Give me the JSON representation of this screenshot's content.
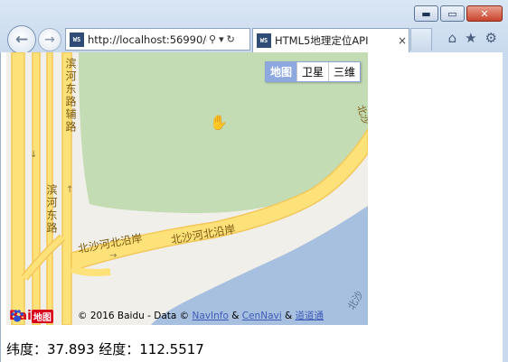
{
  "window": {
    "controls": [
      "minimize-icon",
      "maximize-icon",
      "close-icon"
    ],
    "minimize_glyph": "▬",
    "maximize_glyph": "▭",
    "close_glyph": "✕"
  },
  "nav": {
    "back_glyph": "←",
    "forward_glyph": "→"
  },
  "address_bar": {
    "favicon_text": "WS",
    "url": "http://localhost:56990/c",
    "search_glyph": "⚲",
    "dropdown_glyph": "▾",
    "refresh_glyph": "↻"
  },
  "tab": {
    "favicon_text": "WS",
    "title": "HTML5地理定位API",
    "close_glyph": "×"
  },
  "toolbar": {
    "home_glyph": "⌂",
    "favorites_glyph": "★",
    "settings_glyph": "⚙"
  },
  "map": {
    "type_buttons": [
      {
        "label": "地图",
        "active": true
      },
      {
        "label": "卫星",
        "active": false
      },
      {
        "label": "三维",
        "active": false
      }
    ],
    "road_labels": {
      "vertical_road_1": "滨河东路辅路",
      "vertical_road_2": "滨河东路",
      "diagonal_road_1": "北沙河北沿岸",
      "diagonal_road_2": "北沙河北沿岸",
      "right_edge_1": "北沙",
      "right_edge_2": "北沙"
    },
    "logo": {
      "bai": "Bai",
      "du": "地图"
    },
    "copyright": {
      "prefix": "© 2016 Baidu - Data ©",
      "navinfo": "NavInfo",
      "amp1": "&",
      "cennavi": "CenNavi",
      "amp2": "&",
      "daodao": "道道通"
    },
    "colors": {
      "land": "#f1efe9",
      "park": "#c3dcb4",
      "water": "#a8c0e0",
      "road": "#fde27a",
      "road_edge": "#f3c75a"
    }
  },
  "result": {
    "text": "纬度：37.893 经度：112.5517"
  }
}
